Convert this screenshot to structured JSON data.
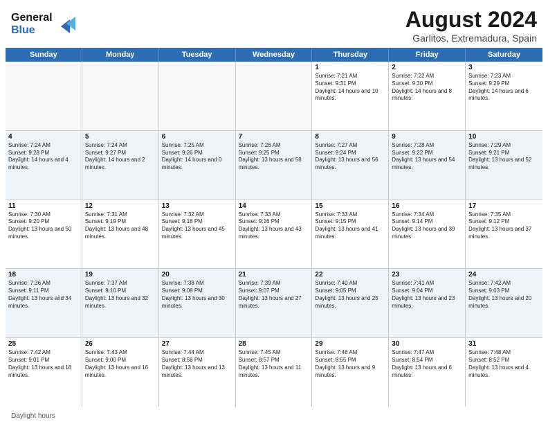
{
  "header": {
    "logo_line1": "General",
    "logo_line2": "Blue",
    "month_year": "August 2024",
    "location": "Garlitos, Extremadura, Spain"
  },
  "days_of_week": [
    "Sunday",
    "Monday",
    "Tuesday",
    "Wednesday",
    "Thursday",
    "Friday",
    "Saturday"
  ],
  "footer": {
    "label": "Daylight hours"
  },
  "weeks": [
    {
      "alt": false,
      "cells": [
        {
          "day": "",
          "sunrise": "",
          "sunset": "",
          "daylight": "",
          "empty": true
        },
        {
          "day": "",
          "sunrise": "",
          "sunset": "",
          "daylight": "",
          "empty": true
        },
        {
          "day": "",
          "sunrise": "",
          "sunset": "",
          "daylight": "",
          "empty": true
        },
        {
          "day": "",
          "sunrise": "",
          "sunset": "",
          "daylight": "",
          "empty": true
        },
        {
          "day": "1",
          "sunrise": "Sunrise: 7:21 AM",
          "sunset": "Sunset: 9:31 PM",
          "daylight": "Daylight: 14 hours and 10 minutes."
        },
        {
          "day": "2",
          "sunrise": "Sunrise: 7:22 AM",
          "sunset": "Sunset: 9:30 PM",
          "daylight": "Daylight: 14 hours and 8 minutes."
        },
        {
          "day": "3",
          "sunrise": "Sunrise: 7:23 AM",
          "sunset": "Sunset: 9:29 PM",
          "daylight": "Daylight: 14 hours and 6 minutes."
        }
      ]
    },
    {
      "alt": true,
      "cells": [
        {
          "day": "4",
          "sunrise": "Sunrise: 7:24 AM",
          "sunset": "Sunset: 9:28 PM",
          "daylight": "Daylight: 14 hours and 4 minutes."
        },
        {
          "day": "5",
          "sunrise": "Sunrise: 7:24 AM",
          "sunset": "Sunset: 9:27 PM",
          "daylight": "Daylight: 14 hours and 2 minutes."
        },
        {
          "day": "6",
          "sunrise": "Sunrise: 7:25 AM",
          "sunset": "Sunset: 9:26 PM",
          "daylight": "Daylight: 14 hours and 0 minutes."
        },
        {
          "day": "7",
          "sunrise": "Sunrise: 7:26 AM",
          "sunset": "Sunset: 9:25 PM",
          "daylight": "Daylight: 13 hours and 58 minutes."
        },
        {
          "day": "8",
          "sunrise": "Sunrise: 7:27 AM",
          "sunset": "Sunset: 9:24 PM",
          "daylight": "Daylight: 13 hours and 56 minutes."
        },
        {
          "day": "9",
          "sunrise": "Sunrise: 7:28 AM",
          "sunset": "Sunset: 9:22 PM",
          "daylight": "Daylight: 13 hours and 54 minutes."
        },
        {
          "day": "10",
          "sunrise": "Sunrise: 7:29 AM",
          "sunset": "Sunset: 9:21 PM",
          "daylight": "Daylight: 13 hours and 52 minutes."
        }
      ]
    },
    {
      "alt": false,
      "cells": [
        {
          "day": "11",
          "sunrise": "Sunrise: 7:30 AM",
          "sunset": "Sunset: 9:20 PM",
          "daylight": "Daylight: 13 hours and 50 minutes."
        },
        {
          "day": "12",
          "sunrise": "Sunrise: 7:31 AM",
          "sunset": "Sunset: 9:19 PM",
          "daylight": "Daylight: 13 hours and 48 minutes."
        },
        {
          "day": "13",
          "sunrise": "Sunrise: 7:32 AM",
          "sunset": "Sunset: 9:18 PM",
          "daylight": "Daylight: 13 hours and 45 minutes."
        },
        {
          "day": "14",
          "sunrise": "Sunrise: 7:33 AM",
          "sunset": "Sunset: 9:16 PM",
          "daylight": "Daylight: 13 hours and 43 minutes."
        },
        {
          "day": "15",
          "sunrise": "Sunrise: 7:33 AM",
          "sunset": "Sunset: 9:15 PM",
          "daylight": "Daylight: 13 hours and 41 minutes."
        },
        {
          "day": "16",
          "sunrise": "Sunrise: 7:34 AM",
          "sunset": "Sunset: 9:14 PM",
          "daylight": "Daylight: 13 hours and 39 minutes."
        },
        {
          "day": "17",
          "sunrise": "Sunrise: 7:35 AM",
          "sunset": "Sunset: 9:12 PM",
          "daylight": "Daylight: 13 hours and 37 minutes."
        }
      ]
    },
    {
      "alt": true,
      "cells": [
        {
          "day": "18",
          "sunrise": "Sunrise: 7:36 AM",
          "sunset": "Sunset: 9:11 PM",
          "daylight": "Daylight: 13 hours and 34 minutes."
        },
        {
          "day": "19",
          "sunrise": "Sunrise: 7:37 AM",
          "sunset": "Sunset: 9:10 PM",
          "daylight": "Daylight: 13 hours and 32 minutes."
        },
        {
          "day": "20",
          "sunrise": "Sunrise: 7:38 AM",
          "sunset": "Sunset: 9:08 PM",
          "daylight": "Daylight: 13 hours and 30 minutes."
        },
        {
          "day": "21",
          "sunrise": "Sunrise: 7:39 AM",
          "sunset": "Sunset: 9:07 PM",
          "daylight": "Daylight: 13 hours and 27 minutes."
        },
        {
          "day": "22",
          "sunrise": "Sunrise: 7:40 AM",
          "sunset": "Sunset: 9:05 PM",
          "daylight": "Daylight: 13 hours and 25 minutes."
        },
        {
          "day": "23",
          "sunrise": "Sunrise: 7:41 AM",
          "sunset": "Sunset: 9:04 PM",
          "daylight": "Daylight: 13 hours and 23 minutes."
        },
        {
          "day": "24",
          "sunrise": "Sunrise: 7:42 AM",
          "sunset": "Sunset: 9:03 PM",
          "daylight": "Daylight: 13 hours and 20 minutes."
        }
      ]
    },
    {
      "alt": false,
      "cells": [
        {
          "day": "25",
          "sunrise": "Sunrise: 7:42 AM",
          "sunset": "Sunset: 9:01 PM",
          "daylight": "Daylight: 13 hours and 18 minutes."
        },
        {
          "day": "26",
          "sunrise": "Sunrise: 7:43 AM",
          "sunset": "Sunset: 9:00 PM",
          "daylight": "Daylight: 13 hours and 16 minutes."
        },
        {
          "day": "27",
          "sunrise": "Sunrise: 7:44 AM",
          "sunset": "Sunset: 8:58 PM",
          "daylight": "Daylight: 13 hours and 13 minutes."
        },
        {
          "day": "28",
          "sunrise": "Sunrise: 7:45 AM",
          "sunset": "Sunset: 8:57 PM",
          "daylight": "Daylight: 13 hours and 11 minutes."
        },
        {
          "day": "29",
          "sunrise": "Sunrise: 7:46 AM",
          "sunset": "Sunset: 8:55 PM",
          "daylight": "Daylight: 13 hours and 9 minutes."
        },
        {
          "day": "30",
          "sunrise": "Sunrise: 7:47 AM",
          "sunset": "Sunset: 8:54 PM",
          "daylight": "Daylight: 13 hours and 6 minutes."
        },
        {
          "day": "31",
          "sunrise": "Sunrise: 7:48 AM",
          "sunset": "Sunset: 8:52 PM",
          "daylight": "Daylight: 13 hours and 4 minutes."
        }
      ]
    }
  ]
}
